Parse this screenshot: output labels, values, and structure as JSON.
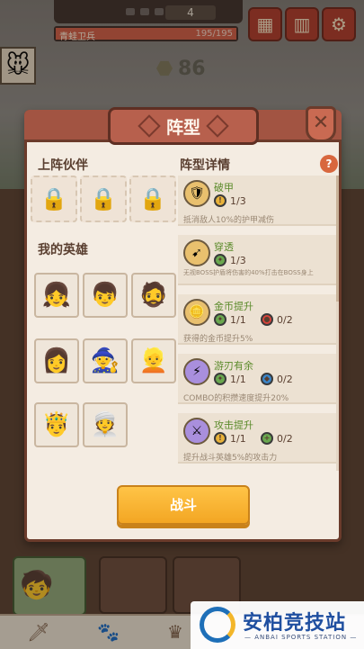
{
  "hud": {
    "wave": "4",
    "boss_name": "青蛙卫兵",
    "boss_hp": "195/195",
    "coins": "86",
    "boss_hp_fraction": 1.0
  },
  "icons": {
    "calendar": "calendar-icon",
    "ranking": "bar-chart-icon",
    "settings": "gear-icon"
  },
  "modal": {
    "title": "阵型",
    "close_label": "✕",
    "team_title": "上阵伙伴",
    "heroes_title": "我的英雄",
    "formation_title": "阵型详情",
    "help_label": "?",
    "battle_label": "战斗"
  },
  "formations": [
    {
      "name": "破甲",
      "req1": "1/3",
      "req2": "",
      "desc": "抵消敌人10%的护甲减伤"
    },
    {
      "name": "穿透",
      "req1": "1/3",
      "req2": "",
      "desc": "无视BOSS护盾将伤害的40%打击在BOSS身上"
    },
    {
      "name": "金币提升",
      "req1": "1/1",
      "req2": "0/2",
      "desc": "获得的金币提升5%"
    },
    {
      "name": "游刃有余",
      "req1": "1/1",
      "req2": "0/2",
      "desc": "COMBO的积攒速度提升20%"
    },
    {
      "name": "攻击提升",
      "req1": "1/1",
      "req2": "0/2",
      "desc": "提升战斗英雄5%的攻击力"
    }
  ],
  "watermark": {
    "title": "安柏竞技站",
    "subtitle": "— ANBAI SPORTS STATION —"
  },
  "colors": {
    "modal_bg": "#f4ece2",
    "header": "#a25442",
    "accent_orange": "#f3a623",
    "green_text": "#5a8a2a"
  }
}
